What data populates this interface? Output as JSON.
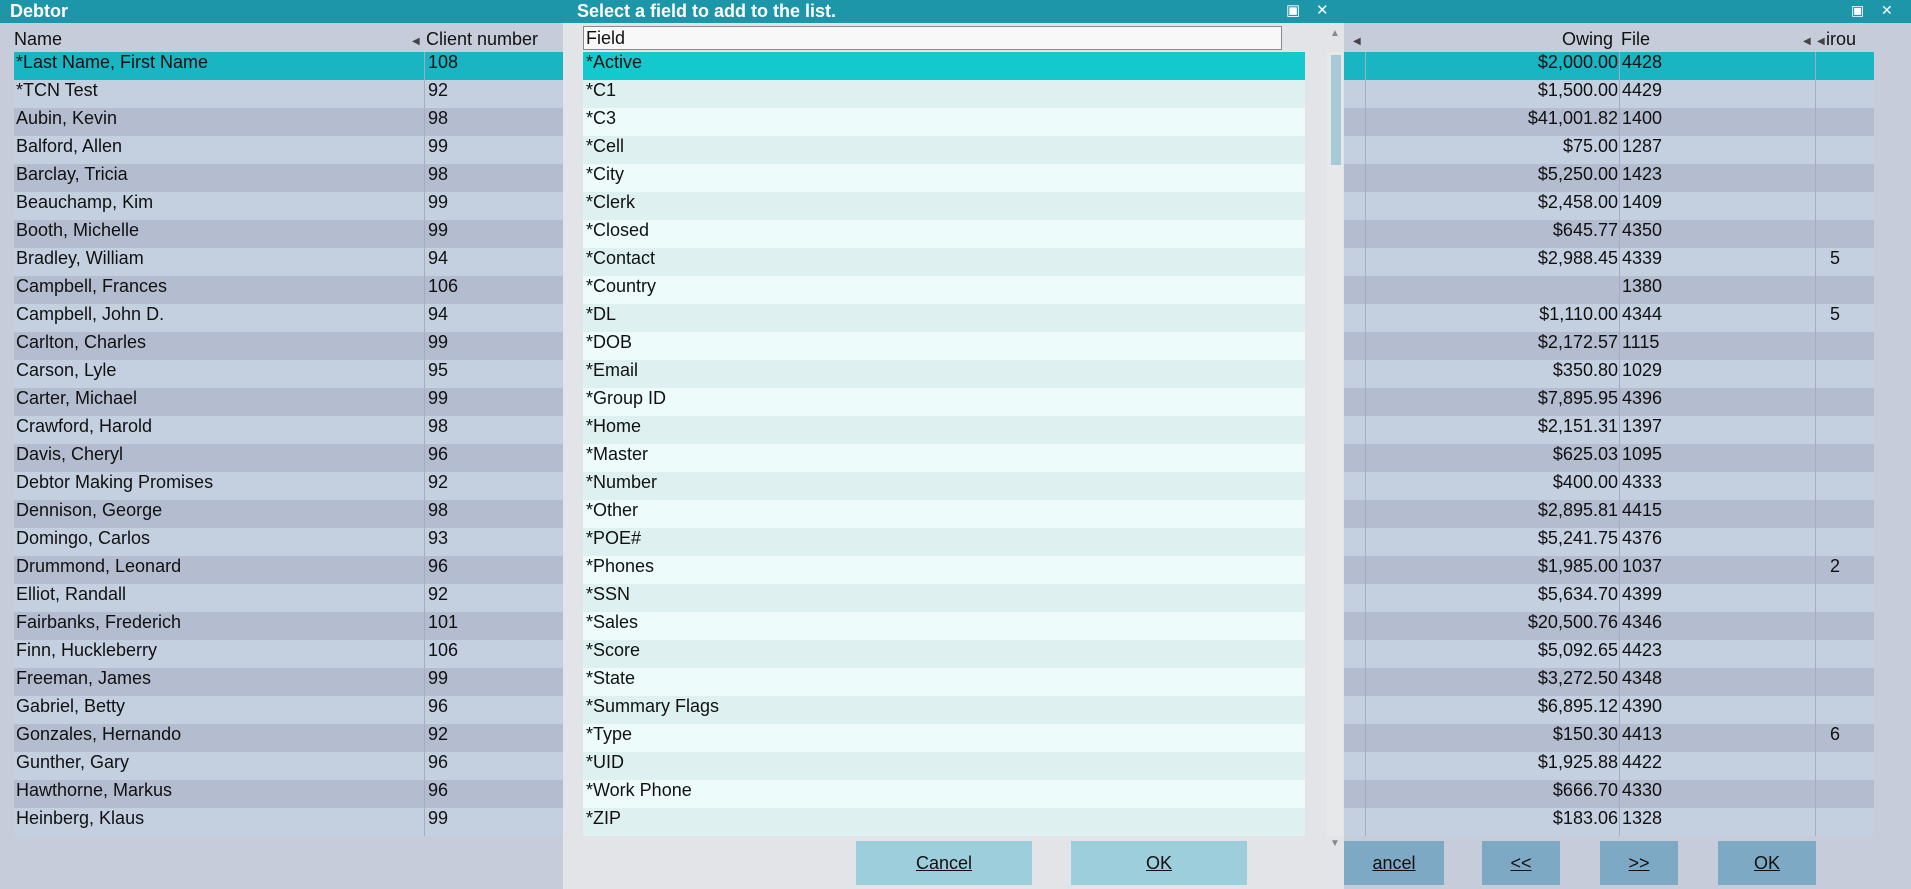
{
  "debtor_window": {
    "title": "Debtor",
    "minimize_glyph": "▣",
    "close_glyph": "✕",
    "columns": {
      "name": "Name",
      "client_number": "Client number",
      "owing": "Owing",
      "file": "File",
      "group_partial": "irou"
    },
    "rows": [
      {
        "name": "*Last Name, First Name",
        "client": "108",
        "owing": "$2,000.00",
        "file": "4428",
        "group": ""
      },
      {
        "name": "*TCN Test",
        "client": "92",
        "owing": "$1,500.00",
        "file": "4429",
        "group": ""
      },
      {
        "name": "Aubin, Kevin",
        "client": "98",
        "owing": "$41,001.82",
        "file": "1400",
        "group": ""
      },
      {
        "name": "Balford, Allen",
        "client": "99",
        "owing": "$75.00",
        "file": "1287",
        "group": ""
      },
      {
        "name": "Barclay, Tricia",
        "client": "98",
        "owing": "$5,250.00",
        "file": "1423",
        "group": ""
      },
      {
        "name": "Beauchamp, Kim",
        "client": "99",
        "owing": "$2,458.00",
        "file": "1409",
        "group": ""
      },
      {
        "name": "Booth, Michelle",
        "client": "99",
        "owing": "$645.77",
        "file": "4350",
        "group": ""
      },
      {
        "name": "Bradley, William",
        "client": "94",
        "owing": "$2,988.45",
        "file": "4339",
        "group": "5"
      },
      {
        "name": "Campbell, Frances",
        "client": "106",
        "owing": "",
        "file": "1380",
        "group": ""
      },
      {
        "name": "Campbell, John D.",
        "client": "94",
        "owing": "$1,110.00",
        "file": "4344",
        "group": "5"
      },
      {
        "name": "Carlton, Charles",
        "client": "99",
        "owing": "$2,172.57",
        "file": "1115",
        "group": ""
      },
      {
        "name": "Carson, Lyle",
        "client": "95",
        "owing": "$350.80",
        "file": "1029",
        "group": ""
      },
      {
        "name": "Carter, Michael",
        "client": "99",
        "owing": "$7,895.95",
        "file": "4396",
        "group": ""
      },
      {
        "name": "Crawford, Harold",
        "client": "98",
        "owing": "$2,151.31",
        "file": "1397",
        "group": ""
      },
      {
        "name": "Davis, Cheryl",
        "client": "96",
        "owing": "$625.03",
        "file": "1095",
        "group": ""
      },
      {
        "name": "Debtor Making Promises",
        "client": "92",
        "owing": "$400.00",
        "file": "4333",
        "group": ""
      },
      {
        "name": "Dennison, George",
        "client": "98",
        "owing": "$2,895.81",
        "file": "4415",
        "group": ""
      },
      {
        "name": "Domingo, Carlos",
        "client": "93",
        "owing": "$5,241.75",
        "file": "4376",
        "group": ""
      },
      {
        "name": "Drummond, Leonard",
        "client": "96",
        "owing": "$1,985.00",
        "file": "1037",
        "group": "2"
      },
      {
        "name": "Elliot, Randall",
        "client": "92",
        "owing": "$5,634.70",
        "file": "4399",
        "group": ""
      },
      {
        "name": "Fairbanks, Frederich",
        "client": "101",
        "owing": "$20,500.76",
        "file": "4346",
        "group": ""
      },
      {
        "name": "Finn, Huckleberry",
        "client": "106",
        "owing": "$5,092.65",
        "file": "4423",
        "group": ""
      },
      {
        "name": "Freeman, James",
        "client": "99",
        "owing": "$3,272.50",
        "file": "4348",
        "group": ""
      },
      {
        "name": "Gabriel, Betty",
        "client": "96",
        "owing": "$6,895.12",
        "file": "4390",
        "group": ""
      },
      {
        "name": "Gonzales, Hernando",
        "client": "92",
        "owing": "$150.30",
        "file": "4413",
        "group": "6"
      },
      {
        "name": "Gunther, Gary",
        "client": "96",
        "owing": "$1,925.88",
        "file": "4422",
        "group": ""
      },
      {
        "name": "Hawthorne, Markus",
        "client": "96",
        "owing": "$666.70",
        "file": "4330",
        "group": ""
      },
      {
        "name": "Heinberg, Klaus",
        "client": "99",
        "owing": "$183.06",
        "file": "1328",
        "group": ""
      }
    ],
    "buttons": {
      "cancel_partial": "ancel",
      "prev": "<<",
      "next": ">>",
      "ok": "OK"
    }
  },
  "dialog": {
    "title": "Select a field to add to the list.",
    "minimize_glyph": "▣",
    "close_glyph": "✕",
    "field_header": "Field",
    "items": [
      "*Active",
      "*C1",
      "*C3",
      "*Cell",
      "*City",
      "*Clerk",
      "*Closed",
      "*Contact",
      "*Country",
      "*DL",
      "*DOB",
      "*Email",
      "*Group ID",
      "*Home",
      "*Master",
      "*Number",
      "*Other",
      "*POE#",
      "*Phones",
      "*SSN",
      "*Sales",
      "*Score",
      "*State",
      "*Summary Flags",
      "*Type",
      "*UID",
      "*Work Phone",
      "*ZIP"
    ],
    "selected_index": 0,
    "cancel_label": "Cancel",
    "ok_label": "OK"
  },
  "colors": {
    "title_bar": "#1d96aa",
    "selected_row": "#1ab5c3",
    "selected_item": "#14c9cd",
    "button": "#9ccedb"
  }
}
